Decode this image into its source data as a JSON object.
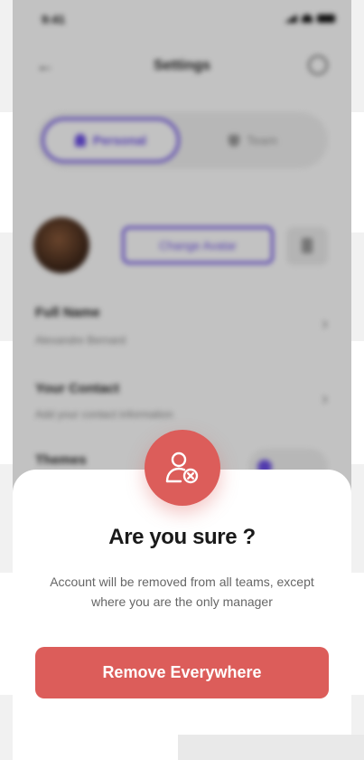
{
  "status_bar": {
    "time": "9:41"
  },
  "header": {
    "title": "Settings",
    "back_icon": "arrow-left-icon",
    "help_icon": "help-circle-icon"
  },
  "segments": {
    "personal": "Personal",
    "team": "Team"
  },
  "avatar_section": {
    "change_label": "Change Avatar"
  },
  "rows": {
    "full_name": {
      "label": "Full Name",
      "value": "Alexandre Bernard"
    },
    "contact": {
      "label": "Your Contact",
      "value": "Add your contact information"
    },
    "themes": {
      "label": "Themes"
    }
  },
  "dialog": {
    "icon": "user-remove-icon",
    "title": "Are you sure ?",
    "message": "Account will be removed from all teams, except where you are the only manager",
    "button_label": "Remove Everywhere"
  },
  "colors": {
    "accent": "#6b4ee6",
    "danger": "#dc5d5a"
  }
}
